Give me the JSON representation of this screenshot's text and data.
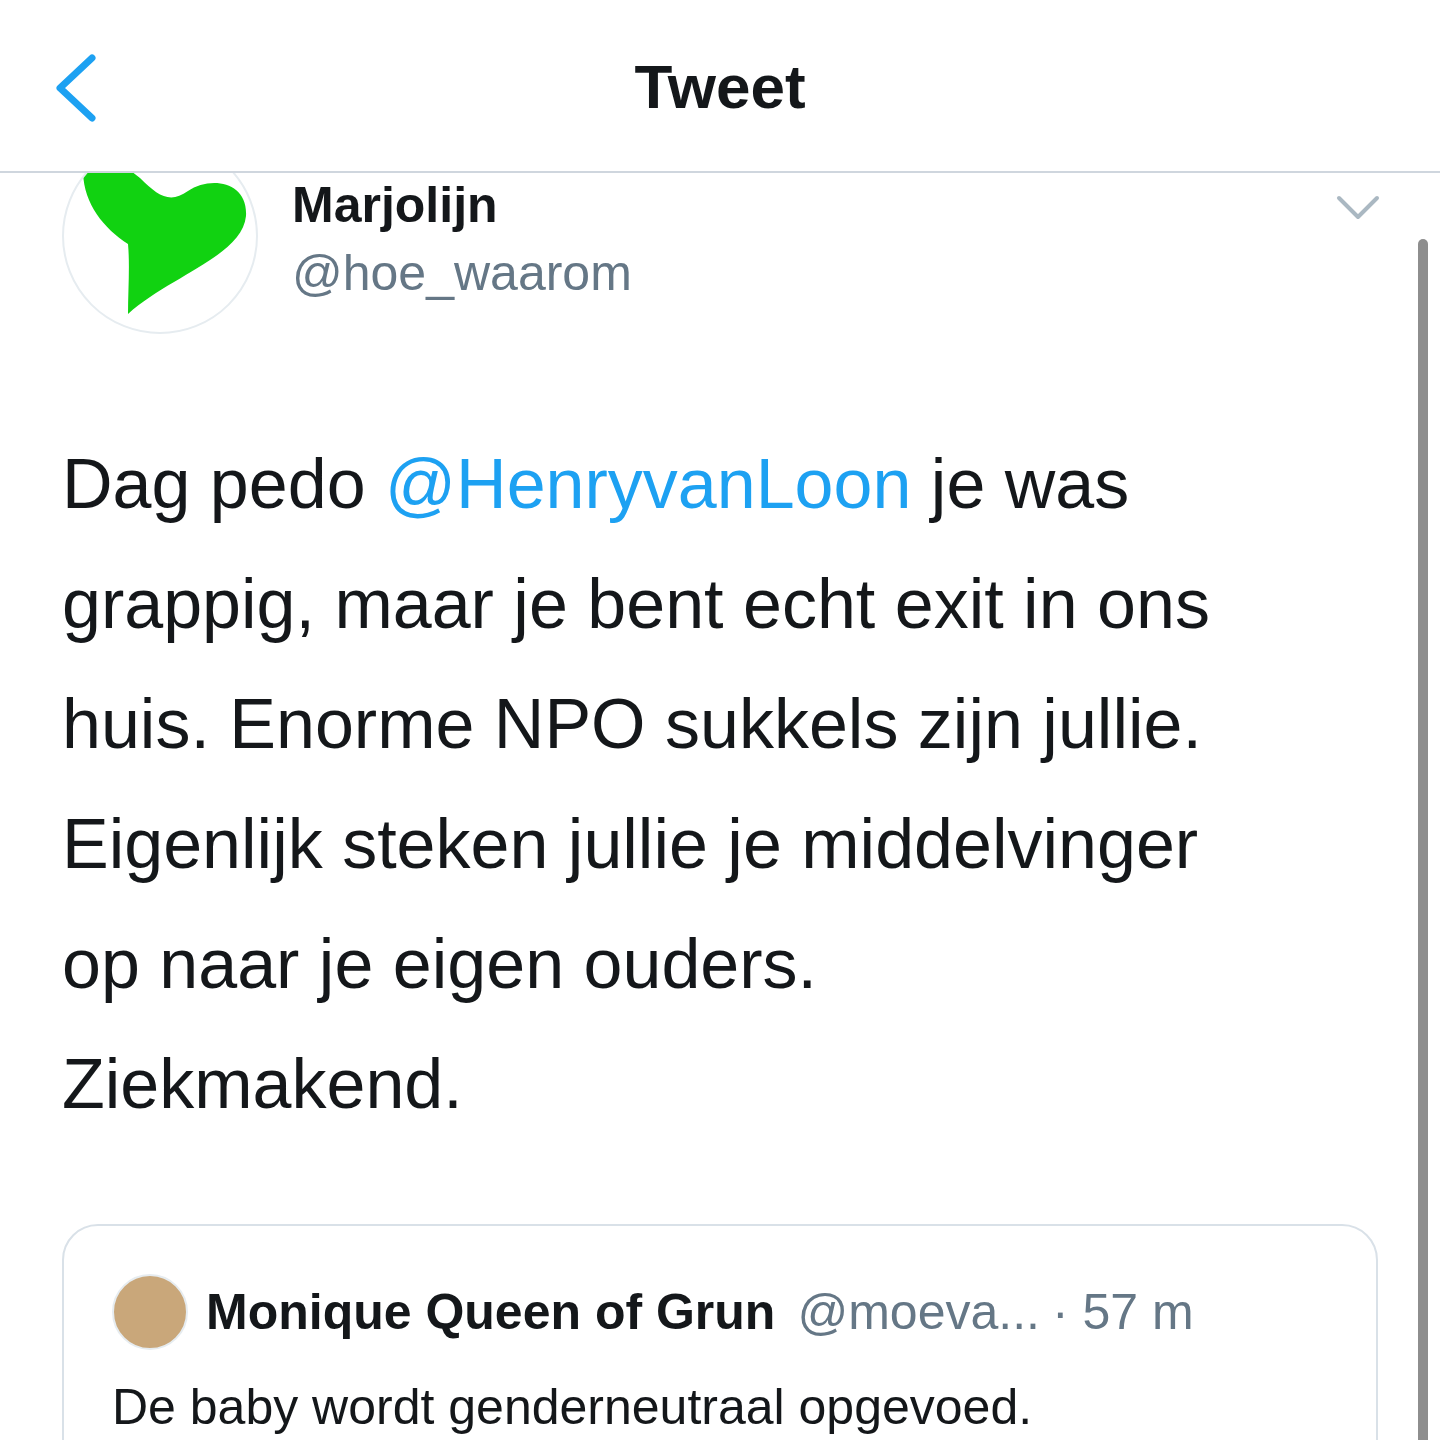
{
  "header": {
    "title": "Tweet"
  },
  "tweet": {
    "name": "Marjolijn",
    "handle": "@hoe_waarom",
    "text": [
      {
        "kind": "text",
        "text": "Dag pedo "
      },
      {
        "kind": "mention",
        "text": "@HenryvanLoon"
      },
      {
        "kind": "text",
        "text": " je was\ngrappig, maar je bent echt exit in ons\nhuis. Enorme NPO sukkels zijn jullie.\nEigenlijk steken jullie je middelvinger\nop naar je eigen ouders.\nZiekmakend."
      }
    ],
    "quoted": {
      "name": "Monique Queen of Grun",
      "handle": "@moeva...",
      "time": "· 57 m",
      "text": "De baby wordt genderneutraal opgevoed."
    }
  }
}
